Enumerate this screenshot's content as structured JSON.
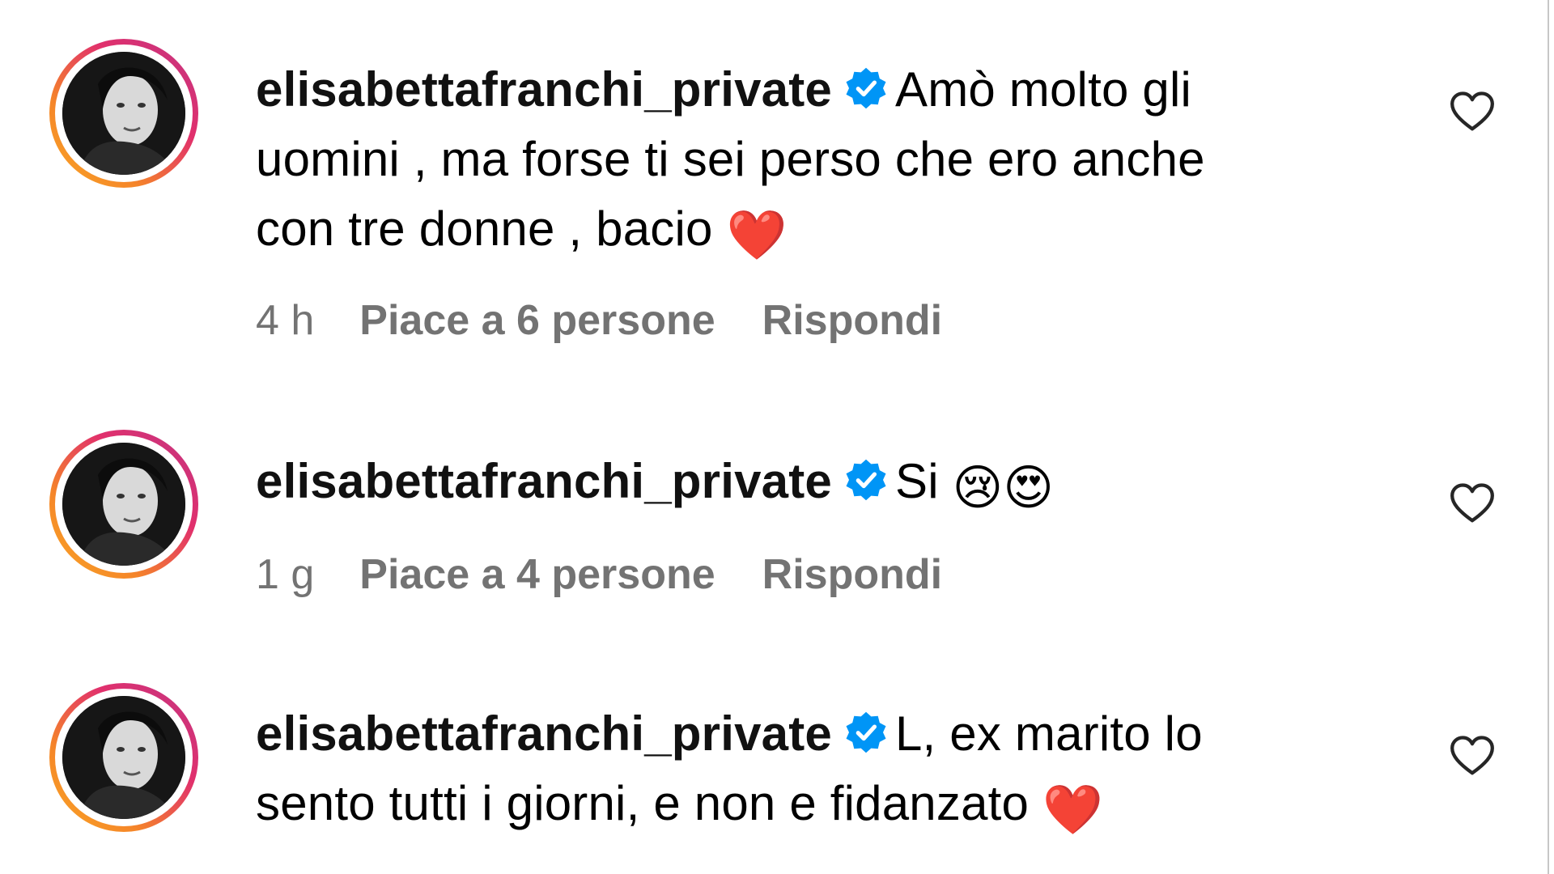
{
  "comments": [
    {
      "username": "elisabettafranchi_private",
      "verified": true,
      "text_lines": [
        "Amò molto gli",
        "uomini , ma forse ti sei perso che ero anche",
        "con tre donne , bacio "
      ],
      "emoji": "❤️",
      "time": "4 h",
      "likes": "Piace a 6 persone",
      "reply": "Rispondi"
    },
    {
      "username": "elisabettafranchi_private",
      "verified": true,
      "text_lines": [
        "Si "
      ],
      "emoji": "😢😍",
      "time": "1 g",
      "likes": "Piace a 4 persone",
      "reply": "Rispondi"
    },
    {
      "username": "elisabettafranchi_private",
      "verified": true,
      "text_lines": [
        "L, ex marito lo",
        "sento tutti i giorni, e non e fidanzato "
      ],
      "emoji": "❤️",
      "time": "",
      "likes": "",
      "reply": ""
    }
  ],
  "icons": {
    "verified": "verified-badge-icon",
    "like": "heart-outline-icon"
  },
  "colors": {
    "verified_blue": "#0095f6",
    "meta_gray": "#737373",
    "heart_red": "#e0202a"
  }
}
